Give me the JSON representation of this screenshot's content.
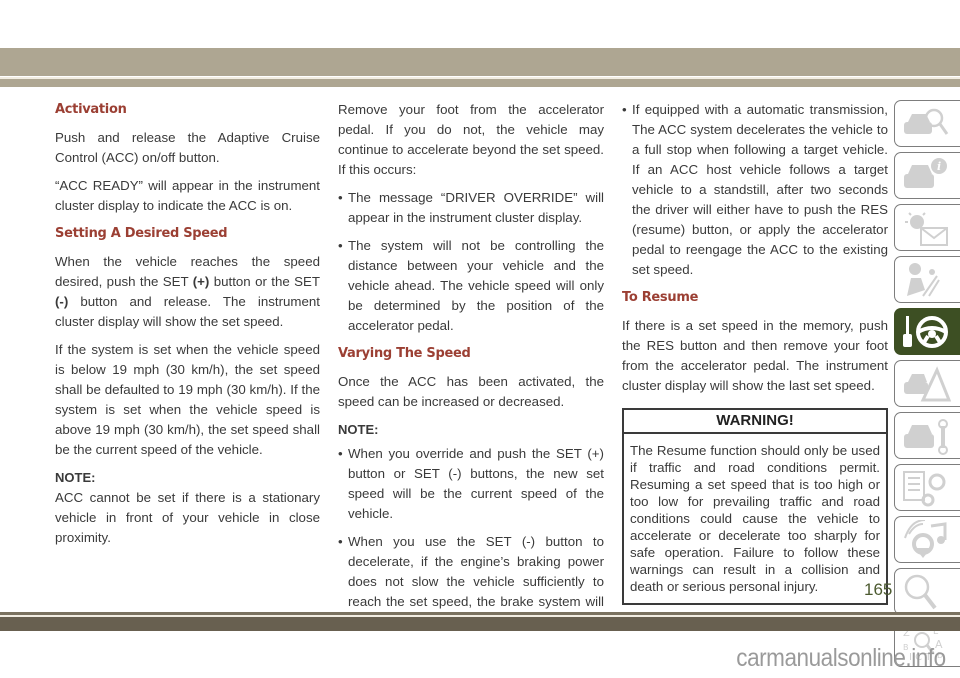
{
  "page": {
    "number": "165",
    "watermark": "carmanualsonline.info",
    "accent_color": "#9b3f33",
    "active_tab_color": "#3d4f23"
  },
  "column1": {
    "activation_heading": "Activation",
    "activation_p1": "Push and release the Adaptive Cruise Control (ACC) on/off button.",
    "activation_p2": "“ACC READY” will appear in the instrument cluster display to indicate the ACC is on.",
    "setting_heading": "Setting A Desired Speed",
    "setting_p1_a": "When the vehicle reaches the speed desired, push the SET ",
    "setting_p1_plus": "(+)",
    "setting_p1_b": " button or the SET ",
    "setting_p1_minus": "(-)",
    "setting_p1_c": " button and release. The instrument cluster display will show the set speed.",
    "setting_p2": "If the system is set when the vehicle speed is below 19 mph (30 km/h), the set speed shall be defaulted to 19 mph (30 km/h). If the system is set when the vehicle speed is above 19 mph (30 km/h), the set speed shall be the current speed of the vehicle.",
    "note_label": "NOTE:",
    "note_text": "ACC cannot be set if there is a stationary vehicle in front of your vehicle in close proximity."
  },
  "column2": {
    "override_p": "Remove your foot from the accelerator pedal. If you do not, the vehicle may continue to accelerate beyond the set speed. If this occurs:",
    "override_bullets": [
      "The message “DRIVER OVERRIDE” will appear in the instrument cluster display.",
      "The system will not be controlling the distance between your vehicle and the vehicle ahead. The vehicle speed will only be determined by the position of the accelerator pedal."
    ],
    "varying_heading": "Varying The Speed",
    "varying_p": "Once the ACC has been activated, the speed can be increased or decreased.",
    "note_label": "NOTE:",
    "note_bullets": [
      "When you override and push the SET (+) button or SET (-) buttons, the new set speed will be the current speed of the vehicle.",
      "When you use the SET (-) button to decelerate, if the engine’s braking power does not slow the vehicle sufficiently to reach the set speed, the brake system will automatically slow the vehicle."
    ]
  },
  "column3": {
    "auto_bullet": "If equipped with a automatic transmission, The ACC system decelerates the vehicle to a full stop when following a target vehicle. If an ACC host vehicle follows a target vehicle to a standstill, after two seconds the driver will either have to push the RES (resume) button, or apply the accelerator pedal to reengage the ACC to the existing set speed.",
    "resume_heading": "To Resume",
    "resume_p": "If there is a set speed in the memory, push the RES button and then remove your foot from the accelerator pedal. The instrument cluster display will show the last set speed.",
    "warning_title": "WARNING!",
    "warning_text": "The Resume function should only be used if traffic and road conditions permit. Resuming a set speed that is too high or too low for prevailing traffic and road conditions could cause the vehicle to accelerate or decelerate too sharply for safe operation. Failure to follow these warnings can result in a collision and death or serious personal injury."
  },
  "tabs": [
    {
      "icon": "car-search-icon",
      "active": false
    },
    {
      "icon": "car-info-icon",
      "active": false
    },
    {
      "icon": "warning-light-message-icon",
      "active": false
    },
    {
      "icon": "airbag-seat-icon",
      "active": false
    },
    {
      "icon": "key-steering-wheel-icon",
      "active": true
    },
    {
      "icon": "car-hazard-icon",
      "active": false
    },
    {
      "icon": "car-wrench-icon",
      "active": false
    },
    {
      "icon": "specs-gear-icon",
      "active": false
    },
    {
      "icon": "multimedia-icon",
      "active": false
    },
    {
      "icon": "search-icon",
      "active": false
    },
    {
      "icon": "index-icon",
      "active": false
    }
  ]
}
